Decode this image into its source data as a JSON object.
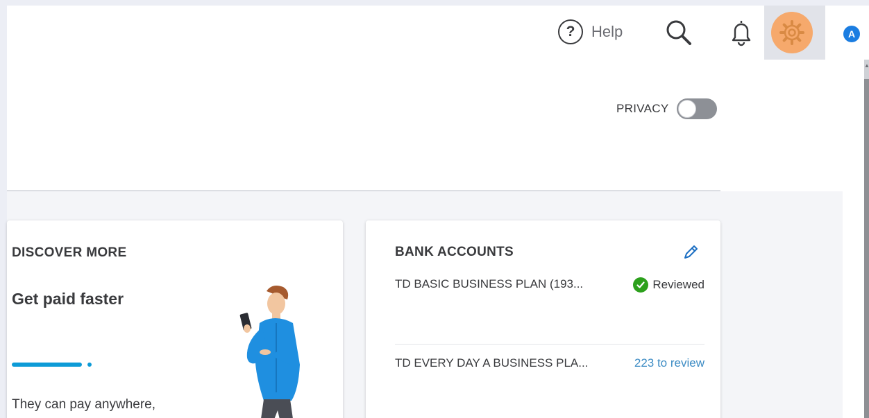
{
  "header": {
    "help_label": "Help",
    "help_glyph": "?",
    "avatar_initial": "A",
    "icons": [
      "help-icon",
      "search-icon",
      "bell-icon",
      "gear-icon"
    ],
    "colors": {
      "gear_active_bg": "#f6a96c",
      "avatar_bg": "#1b7de1"
    }
  },
  "privacy": {
    "label": "PRIVACY",
    "enabled": false
  },
  "discover": {
    "title": "DISCOVER MORE",
    "heading": "Get paid faster",
    "body": "They can pay anywhere,",
    "accent_color": "#0d9bd7"
  },
  "bank": {
    "title": "BANK ACCOUNTS",
    "accounts": [
      {
        "name": "TD BASIC BUSINESS PLAN (193...",
        "status": "Reviewed"
      },
      {
        "name": "TD EVERY DAY A BUSINESS PLA...",
        "status": "223 to review"
      }
    ],
    "colors": {
      "reviewed": "#2ca01c",
      "to_review_link": "#3d8cc4"
    }
  }
}
